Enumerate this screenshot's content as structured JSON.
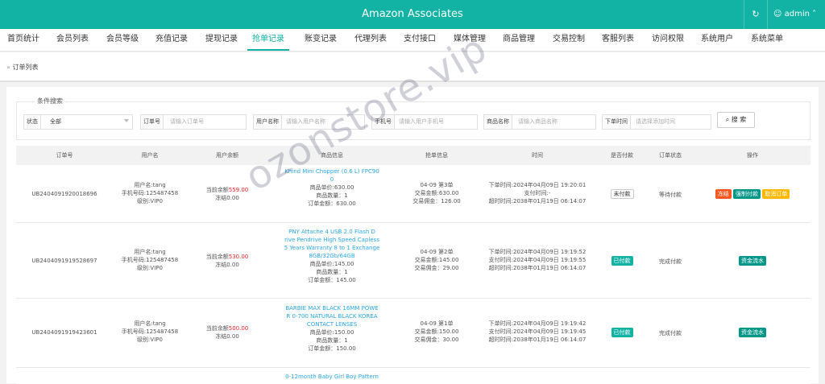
{
  "app": {
    "title": "Amazon Associates",
    "refresh_icon": "refresh-icon",
    "user_icon": "user-icon",
    "username": "admin"
  },
  "menu": [
    {
      "label": "首页统计"
    },
    {
      "label": "会员列表"
    },
    {
      "label": "会员等级"
    },
    {
      "label": "充值记录"
    },
    {
      "label": "提现记录"
    },
    {
      "label": "抢单记录",
      "active": true
    },
    {
      "label": "账变记录"
    },
    {
      "label": "代理列表"
    },
    {
      "label": "支付接口"
    },
    {
      "label": "媒体管理"
    },
    {
      "label": "商品管理"
    },
    {
      "label": "交易控制"
    },
    {
      "label": "客服列表"
    },
    {
      "label": "访问权限"
    },
    {
      "label": "系统用户"
    },
    {
      "label": "系统菜单"
    }
  ],
  "breadcrumb": {
    "prefix": "»",
    "label": "订单列表"
  },
  "search": {
    "legend": "条件搜索",
    "status_label": "状态",
    "status_value": "全部",
    "order_label": "订单号",
    "order_placeholder": "请输入订单号",
    "username_label": "用户名称",
    "username_placeholder": "请输入用户名称",
    "phone_label": "手机号",
    "phone_placeholder": "请输入用户手机号",
    "product_label": "商品名称",
    "product_placeholder": "请输入商品名称",
    "time_label": "下单时间",
    "time_placeholder": "请选择添加时间",
    "button_label": "搜 索",
    "button_icon": "search-icon"
  },
  "table": {
    "headers": [
      "订单号",
      "用户名",
      "用户余额",
      "商品信息",
      "抢单信息",
      "时间",
      "是否付款",
      "订单状态",
      "操作"
    ],
    "rows": [
      {
        "order_no": "UB2404091920018696",
        "user": [
          "用户名:tang",
          "手机号码:125487458",
          "级别:VIP0"
        ],
        "balance_label": "当前余额",
        "balance_value": "559.00",
        "frozen": "冻结0.00",
        "product_name": [
          "Khind Mini Chopper (0.6 L) FPC90",
          "0"
        ],
        "product_info": [
          "商品单价:630.00",
          "商品数量：1",
          "订单金额：630.00"
        ],
        "grab": [
          "04-09 第3单",
          "交易金额:630.00",
          "交易佣金：126.00"
        ],
        "times": [
          "下单时间:2024年04月09日 19:20:01",
          "支付时间:-",
          "超时时间:2038年01月19日 06:14:07"
        ],
        "pay_status": "未付款",
        "order_status": "等待付款",
        "actions": [
          "冻结",
          "强制付款",
          "取消订单"
        ]
      },
      {
        "order_no": "UB2404091919528697",
        "user": [
          "用户名:tang",
          "手机号码:125487458",
          "级别:VIP0"
        ],
        "balance_label": "当前余额",
        "balance_value": "530.00",
        "frozen": "冻结0.00",
        "product_name": [
          "PNY Attache 4 USB 2.0 Flash D",
          "rive Pendrive High Speed Capless",
          "5 Years Warranty 8 to 1 Exchange",
          "8GB/32Gb/64GB"
        ],
        "product_info": [
          "商品单价:145.00",
          "商品数量：1",
          "订单金额：145.00"
        ],
        "grab": [
          "04-09 第2单",
          "交易金额:145.00",
          "交易佣金：29.00"
        ],
        "times": [
          "下单时间:2024年04月09日 19:19:52",
          "支付时间:2024年04月09日 19:19:55",
          "超时时间:2038年01月19日 06:14:07"
        ],
        "pay_status": "已付款",
        "order_status": "完成付款",
        "actions": [
          "资金流水"
        ]
      },
      {
        "order_no": "UB2404091919423601",
        "user": [
          "用户名:tang",
          "手机号码:125487458",
          "级别:VIP0"
        ],
        "balance_label": "当前余额",
        "balance_value": "500.00",
        "frozen": "冻结0.00",
        "product_name": [
          "BARBIE MAX BLACK 16MM POWE",
          "R 0-700 NATURAL BLACK KOREA",
          "CONTACT LENSES"
        ],
        "product_info": [
          "商品单价:150.00",
          "商品数量：1",
          "订单金额：150.00"
        ],
        "grab": [
          "04-09 第1单",
          "交易金额:150.00",
          "交易佣金：30.00"
        ],
        "times": [
          "下单时间:2024年04月09日 19:19:42",
          "支付时间:2024年04月09日 19:19:45",
          "超时时间:2038年01月19日 06:14:07"
        ],
        "pay_status": "已付款",
        "order_status": "完成付款",
        "actions": [
          "资金流水"
        ]
      },
      {
        "product_name": [
          "0-12month Baby Girl Boy Pattern"
        ]
      }
    ]
  },
  "watermark": "ozonstore.vip",
  "colors": {
    "brand": "#12b2a4",
    "link": "#2aa7e8",
    "danger": "#ff5722",
    "warn": "#ffb800",
    "ok": "#009688"
  }
}
